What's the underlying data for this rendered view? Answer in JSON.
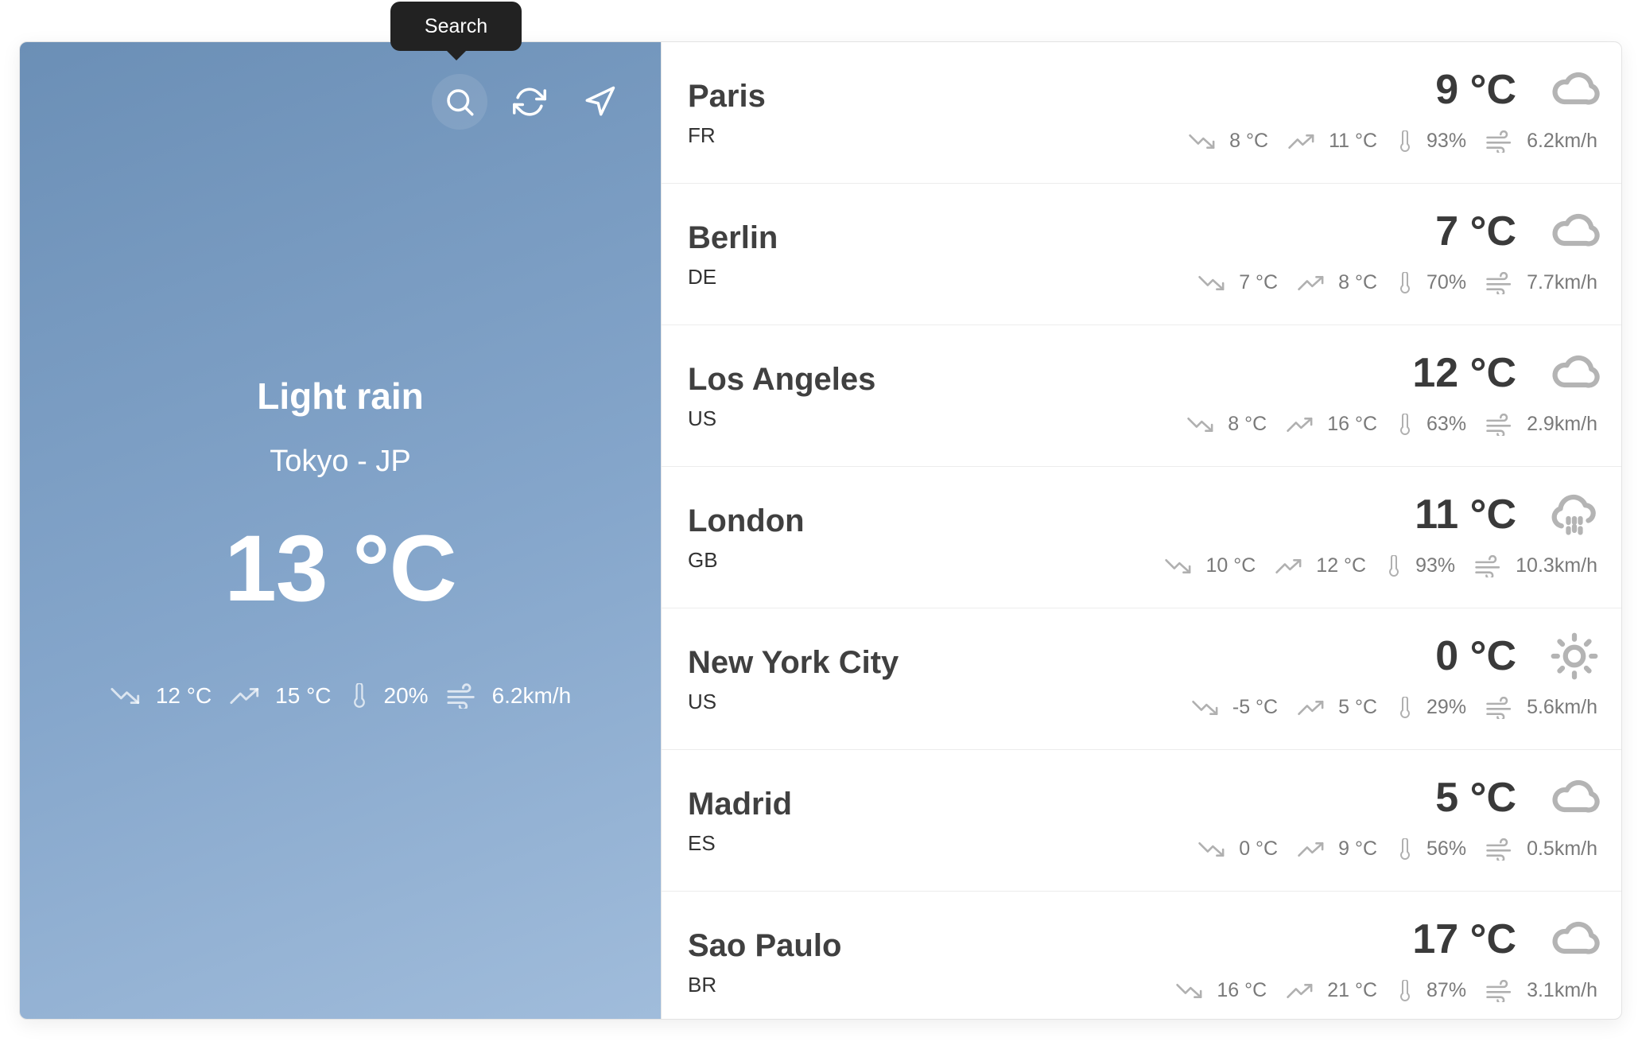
{
  "toolbar": {
    "tooltip": "Search",
    "buttons": [
      {
        "icon": "search-icon"
      },
      {
        "icon": "refresh-icon"
      },
      {
        "icon": "location-arrow-icon"
      }
    ]
  },
  "current": {
    "condition": "Light rain",
    "location": "Tokyo - JP",
    "temperature": "13 °C",
    "min": "12 °C",
    "max": "15 °C",
    "humidity": "20%",
    "wind": "6.2km/h"
  },
  "cities": [
    {
      "name": "Paris",
      "country": "FR",
      "temp": "9 °C",
      "icon": "cloud-icon",
      "min": "8 °C",
      "max": "11 °C",
      "humidity": "93%",
      "wind": "6.2km/h"
    },
    {
      "name": "Berlin",
      "country": "DE",
      "temp": "7 °C",
      "icon": "cloud-icon",
      "min": "7 °C",
      "max": "8 °C",
      "humidity": "70%",
      "wind": "7.7km/h"
    },
    {
      "name": "Los Angeles",
      "country": "US",
      "temp": "12 °C",
      "icon": "cloud-icon",
      "min": "8 °C",
      "max": "16 °C",
      "humidity": "63%",
      "wind": "2.9km/h"
    },
    {
      "name": "London",
      "country": "GB",
      "temp": "11 °C",
      "icon": "cloud-rain-icon",
      "min": "10 °C",
      "max": "12 °C",
      "humidity": "93%",
      "wind": "10.3km/h"
    },
    {
      "name": "New York City",
      "country": "US",
      "temp": "0 °C",
      "icon": "sun-icon",
      "min": "-5 °C",
      "max": "5 °C",
      "humidity": "29%",
      "wind": "5.6km/h"
    },
    {
      "name": "Madrid",
      "country": "ES",
      "temp": "5 °C",
      "icon": "cloud-icon",
      "min": "0 °C",
      "max": "9 °C",
      "humidity": "56%",
      "wind": "0.5km/h"
    },
    {
      "name": "Sao Paulo",
      "country": "BR",
      "temp": "17 °C",
      "icon": "cloud-icon",
      "min": "16 °C",
      "max": "21 °C",
      "humidity": "87%",
      "wind": "3.1km/h"
    }
  ]
}
